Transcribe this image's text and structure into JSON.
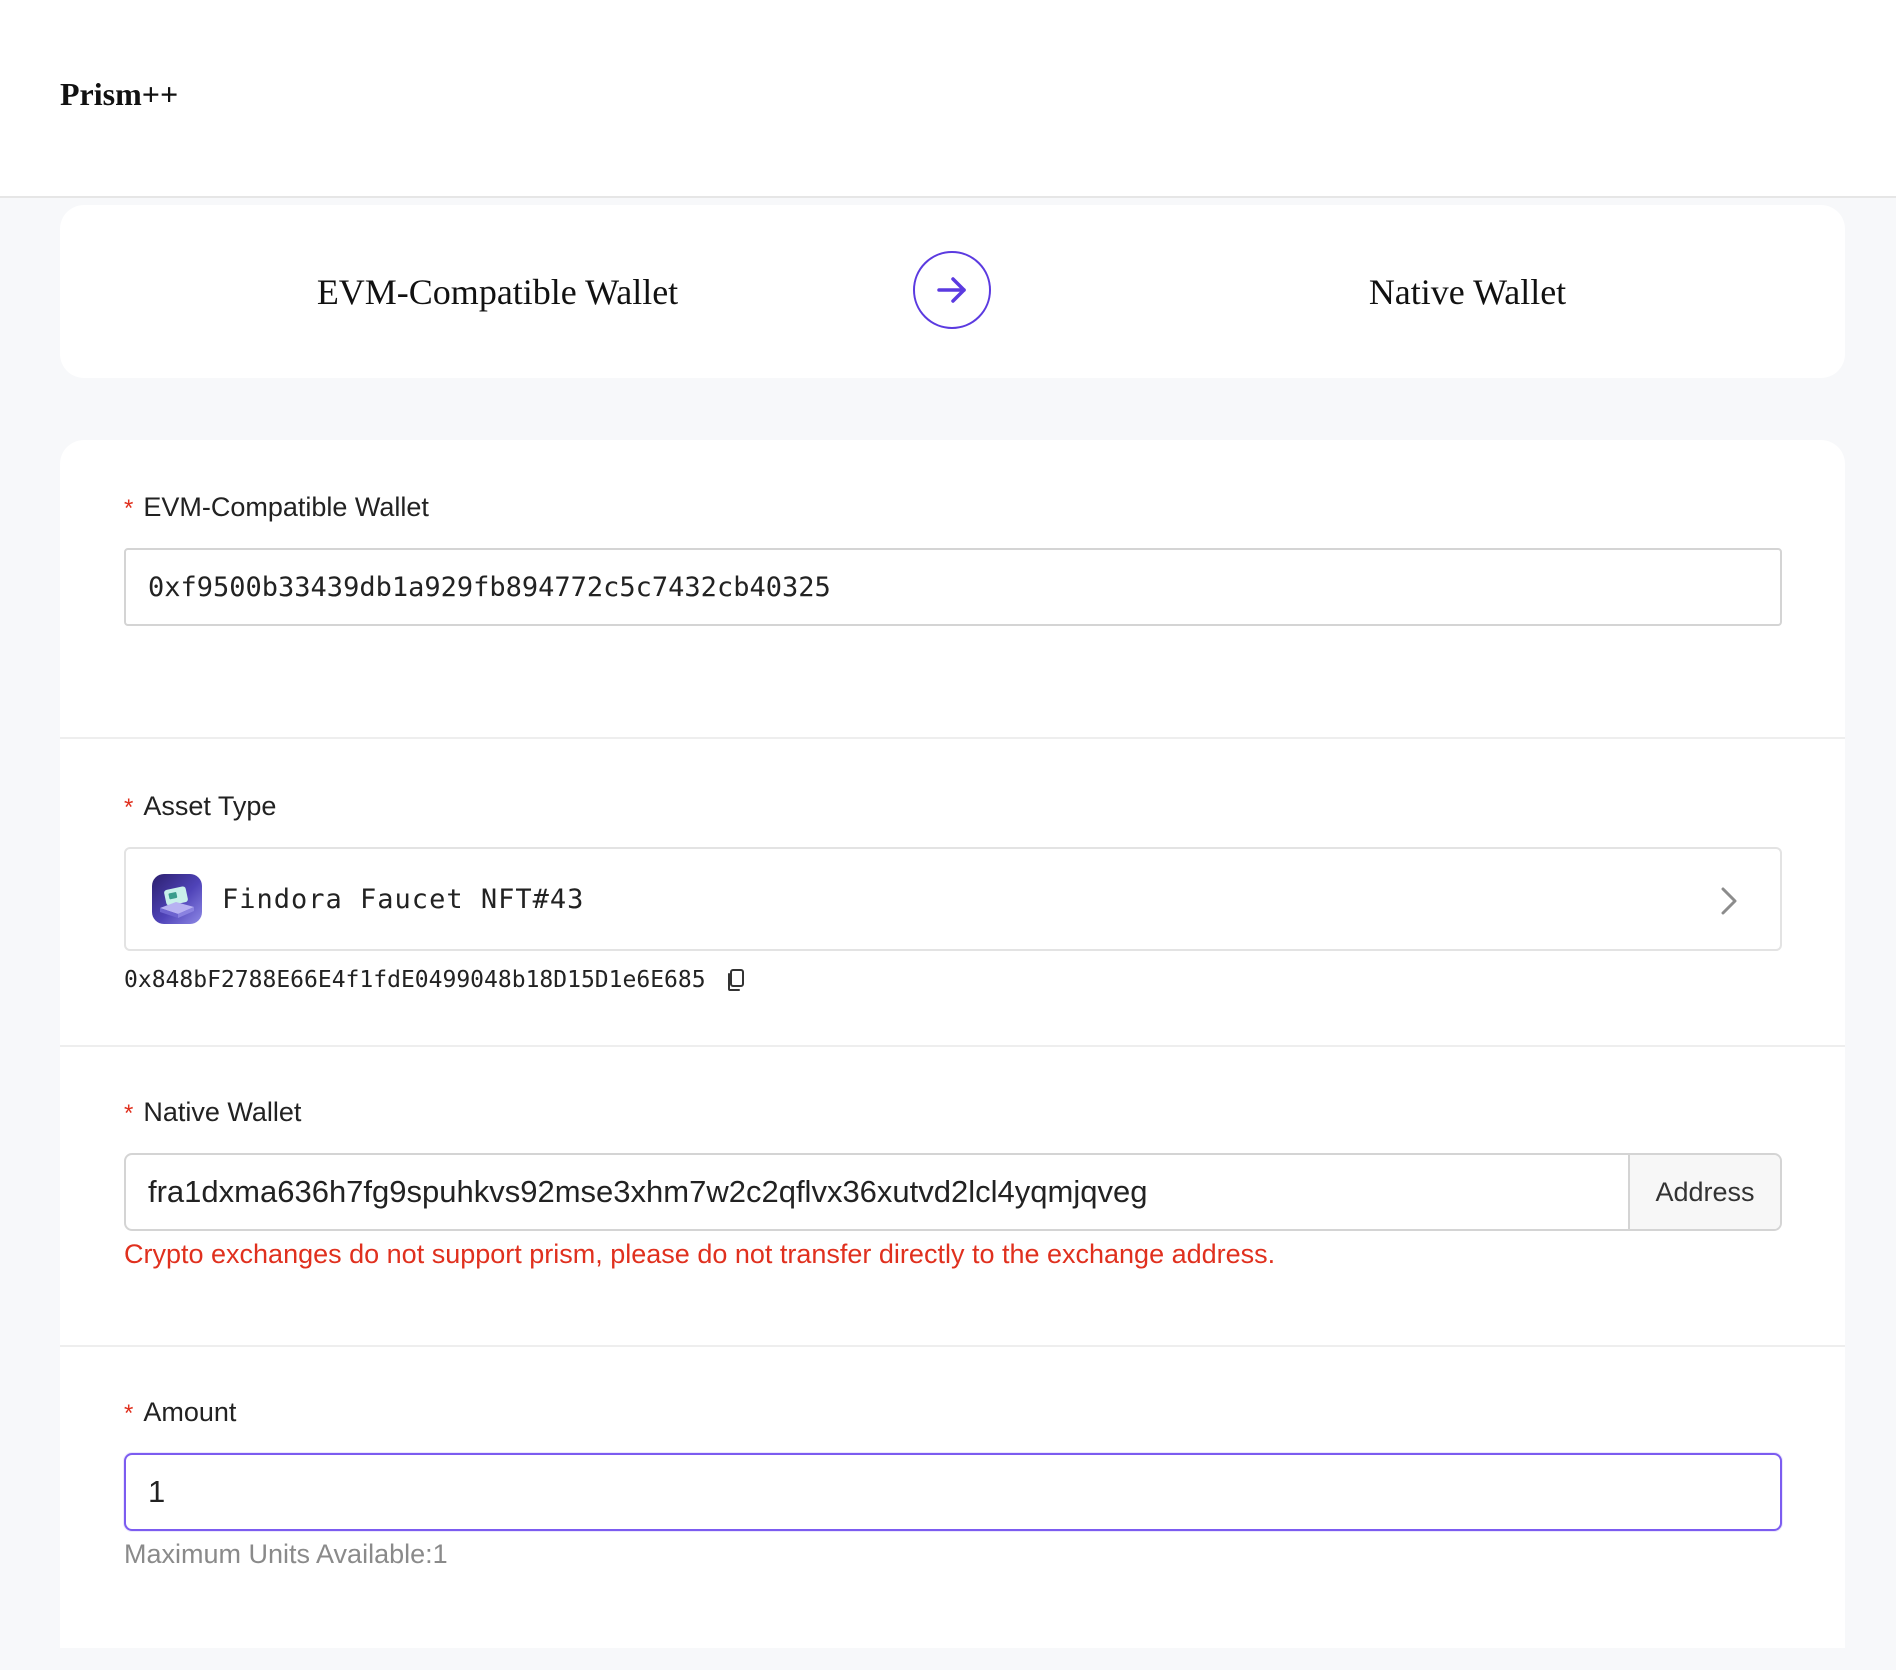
{
  "header": {
    "logo": "Prism++"
  },
  "direction": {
    "from": "EVM-Compatible Wallet",
    "to": "Native Wallet",
    "swap_icon": "arrow-right-icon"
  },
  "form": {
    "required_mark": "*",
    "evm_wallet": {
      "label": "EVM-Compatible Wallet",
      "value": "0xf9500b33439db1a929fb894772c5c7432cb40325"
    },
    "asset_type": {
      "label": "Asset Type",
      "selected": "Findora Faucet NFT#43",
      "contract": "0x848bF2788E66E4f1fdE0499048b18D15D1e6E685",
      "icon": "nft-asset-icon"
    },
    "native_wallet": {
      "label": "Native Wallet",
      "value": "fra1dxma636h7fg9spuhkvs92mse3xhm7w2c2qflvx36xutvd2lcl4yqmjqveg",
      "addon": "Address",
      "warning": "Crypto exchanges do not support prism, please do not transfer directly to the exchange address."
    },
    "amount": {
      "label": "Amount",
      "value": "1",
      "hint": "Maximum Units Available:1"
    }
  },
  "colors": {
    "accent": "#5b3ae0",
    "required": "#e0301e",
    "warning": "#e0301e",
    "hint": "#8a8a8a"
  }
}
